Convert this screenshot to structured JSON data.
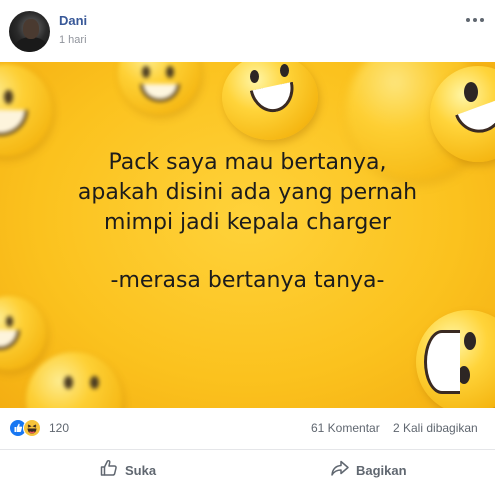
{
  "post": {
    "author": "Dani",
    "time": "1 hari",
    "more_icon": "more-options-icon"
  },
  "image": {
    "lines": [
      "Pack saya mau bertanya,",
      "apakah disini ada yang pernah",
      "mimpi jadi kepala charger"
    ],
    "footer_line": "-merasa bertanya tanya-",
    "background_color": "#fbc21e"
  },
  "stats": {
    "reactions": [
      "like-icon",
      "haha-icon"
    ],
    "reaction_count": "120",
    "comments": "61 Komentar",
    "shares": "2 Kali dibagikan"
  },
  "actions": {
    "like_label": "Suka",
    "share_label": "Bagikan"
  },
  "colors": {
    "author_link": "#385898",
    "secondary_text": "#606770",
    "like_blue": "#1877f2"
  }
}
